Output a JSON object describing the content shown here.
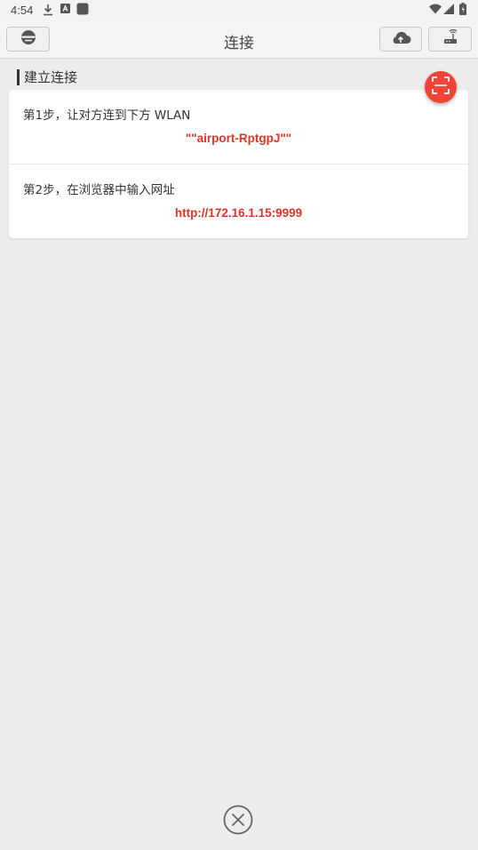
{
  "status_bar": {
    "time": "4:54",
    "icons": [
      "download-icon",
      "font-a-icon",
      "stop-square-icon",
      "wifi-icon",
      "signal-icon",
      "battery-icon"
    ]
  },
  "toolbar": {
    "title": "连接",
    "left_button_icon": "hat-icon",
    "right_button_1_icon": "cloud-upload-icon",
    "right_button_2_icon": "router-icon"
  },
  "section": {
    "title": "建立连接"
  },
  "steps": [
    {
      "label": "第1步，让对方连到下方 WLAN",
      "value": "\"\"airport-RptgpJ\"\""
    },
    {
      "label": "第2步，在浏览器中输入网址",
      "value": "http://172.16.1.15:9999"
    }
  ],
  "fab": {
    "icon": "scan-icon"
  },
  "bottom": {
    "icon": "close-circle-icon"
  },
  "colors": {
    "accent": "#f04438",
    "value_text": "#e03326",
    "background": "#ededed"
  }
}
